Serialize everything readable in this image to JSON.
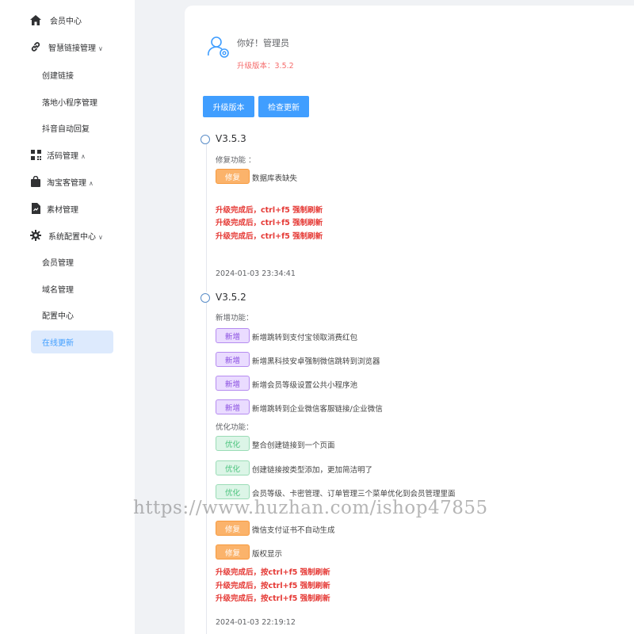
{
  "sidebar": {
    "items": [
      {
        "label": "会员中心",
        "icon": "home-icon"
      },
      {
        "label": "智慧链接管理",
        "icon": "link-icon",
        "caret": "∨"
      },
      {
        "label": "活码管理",
        "icon": "qrcode-icon",
        "caret": "∧"
      },
      {
        "label": "淘宝客管理",
        "icon": "shopping-bag-icon",
        "caret": "∧"
      },
      {
        "label": "素材管理",
        "icon": "document-icon"
      },
      {
        "label": "系统配置中心",
        "icon": "gear-icon",
        "caret": "∨"
      }
    ],
    "sub_link": [
      "创建链接",
      "落地小程序管理",
      "抖音自动回复"
    ],
    "sub_system": [
      "会员管理",
      "域名管理",
      "配置中心",
      "在线更新"
    ]
  },
  "header": {
    "greeting": "你好！管理员",
    "version_line": "升级版本：3.5.2"
  },
  "buttons": {
    "upgrade": "升级版本",
    "check": "检查更新"
  },
  "timeline": [
    {
      "version": "V3.5.3",
      "fix_label": "修复功能 ：",
      "fix_items": [
        {
          "tag": "修复",
          "text": "数据库表缺失"
        }
      ],
      "warnings": [
        "升级完成后，ctrl+f5  强制刷新",
        "升级完成后，ctrl+f5  强制刷新",
        "升级完成后，ctrl+f5  强制刷新"
      ],
      "timestamp": "2024-01-03 23:34:41"
    },
    {
      "version": "V3.5.2",
      "new_label": "新增功能：",
      "new_items": [
        {
          "tag": "新增",
          "text": "新增跳转到支付宝领取消费红包"
        },
        {
          "tag": "新增",
          "text": "新增黑科技安卓强制微信跳转到浏览器"
        },
        {
          "tag": "新增",
          "text": "新增会员等级设置公共小程序池"
        },
        {
          "tag": "新增",
          "text": "新增跳转到企业微信客服链接/企业微信"
        }
      ],
      "opt_label": "优化功能：",
      "opt_items": [
        {
          "tag": "优化",
          "text": "整合创建链接到一个页面"
        },
        {
          "tag": "优化",
          "text": "创建链接按类型添加，更加简洁明了"
        },
        {
          "tag": "优化",
          "text": "会员等级、卡密管理、订单管理三个菜单优化到会员管理里面"
        }
      ],
      "fix_items": [
        {
          "tag": "修复",
          "text": "微信支付证书不自动生成"
        },
        {
          "tag": "修复",
          "text": "版权显示"
        }
      ],
      "warnings": [
        "升级完成后，按ctrl+f5  强制刷新",
        "升级完成后，按ctrl+f5  强制刷新",
        "升级完成后，按ctrl+f5  强制刷新"
      ],
      "timestamp": "2024-01-03 22:19:12"
    }
  ],
  "watermark": "https://www.huzhan.com/ishop47855",
  "colors": {
    "primary": "#409eff",
    "danger": "#e53935",
    "fix": "#fbb36b",
    "new": "#b68cf0",
    "opt": "#4cc47e"
  }
}
